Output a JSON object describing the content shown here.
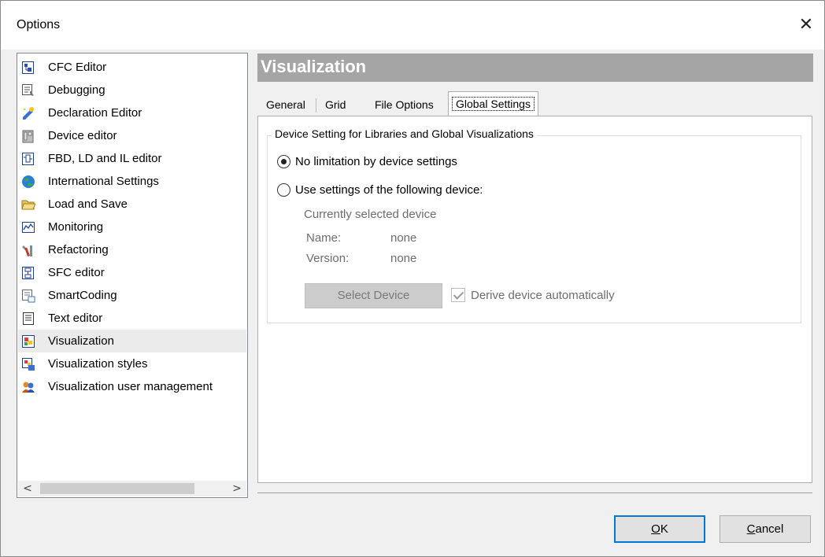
{
  "window": {
    "title": "Options"
  },
  "tree": {
    "items": [
      {
        "label": "CFC Editor",
        "icon": "cfc-editor-icon"
      },
      {
        "label": "Debugging",
        "icon": "debugging-icon"
      },
      {
        "label": "Declaration Editor",
        "icon": "declaration-editor-icon"
      },
      {
        "label": "Device editor",
        "icon": "device-editor-icon"
      },
      {
        "label": "FBD, LD and IL editor",
        "icon": "fbd-ld-il-editor-icon"
      },
      {
        "label": "International Settings",
        "icon": "globe-icon"
      },
      {
        "label": "Load and Save",
        "icon": "folder-open-icon"
      },
      {
        "label": "Monitoring",
        "icon": "monitoring-icon"
      },
      {
        "label": "Refactoring",
        "icon": "tools-icon"
      },
      {
        "label": "SFC editor",
        "icon": "sfc-editor-icon"
      },
      {
        "label": "SmartCoding",
        "icon": "smartcoding-icon"
      },
      {
        "label": "Text editor",
        "icon": "text-editor-icon"
      },
      {
        "label": "Visualization",
        "icon": "visualization-icon",
        "selected": true
      },
      {
        "label": "Visualization styles",
        "icon": "visualization-styles-icon"
      },
      {
        "label": "Visualization user management",
        "icon": "user-management-icon"
      }
    ]
  },
  "panel": {
    "header": "Visualization",
    "tabs": [
      "General",
      "Grid",
      "File Options",
      "Global Settings"
    ],
    "active_tab": "Global Settings",
    "group": {
      "title": "Device Setting for Libraries and Global Visualizations",
      "radio_no_limit": "No limitation by device settings",
      "radio_use_device": "Use settings of the following device:",
      "selected_option": "No limitation by device settings",
      "currently_selected": "Currently selected device",
      "name_label": "Name:",
      "name_value": "none",
      "version_label": "Version:",
      "version_value": "none",
      "select_device_button": "Select Device",
      "derive_checkbox": "Derive device automatically",
      "derive_checked": true
    }
  },
  "buttons": {
    "ok_prefix": "",
    "ok_accel": "O",
    "ok_rest": "K",
    "cancel_accel": "C",
    "cancel_rest": "ancel"
  }
}
